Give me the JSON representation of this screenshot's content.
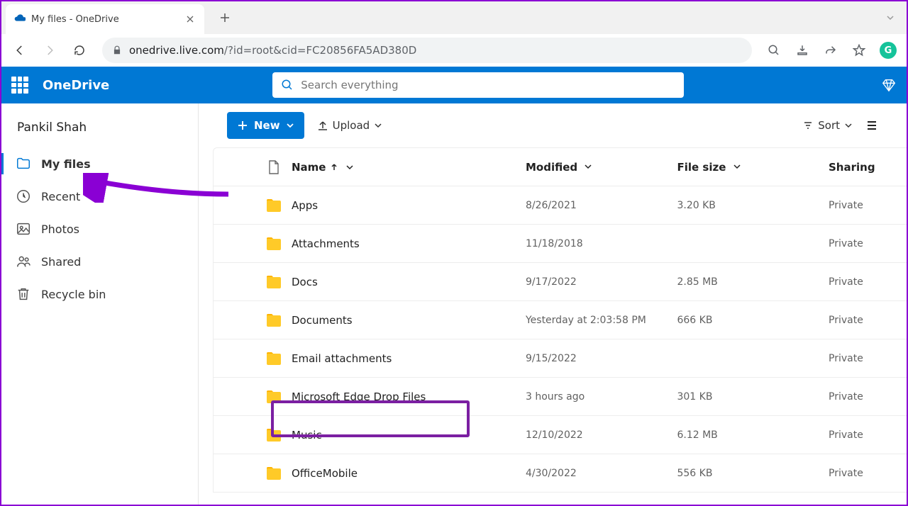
{
  "browser": {
    "tab_title": "My files - OneDrive",
    "url_host": "onedrive.live.com",
    "url_path": "/?id=root&cid=FC20856FA5AD380D"
  },
  "header": {
    "brand": "OneDrive",
    "search_placeholder": "Search everything"
  },
  "user": {
    "name": "Pankil Shah"
  },
  "sidebar": {
    "items": [
      {
        "label": "My files",
        "icon": "folder"
      },
      {
        "label": "Recent",
        "icon": "recent"
      },
      {
        "label": "Photos",
        "icon": "photo"
      },
      {
        "label": "Shared",
        "icon": "people"
      },
      {
        "label": "Recycle bin",
        "icon": "trash"
      }
    ]
  },
  "toolbar": {
    "new_label": "New",
    "upload_label": "Upload",
    "sort_label": "Sort"
  },
  "table": {
    "columns": {
      "name": "Name",
      "modified": "Modified",
      "size": "File size",
      "sharing": "Sharing"
    },
    "rows": [
      {
        "name": "Apps",
        "modified": "8/26/2021",
        "size": "3.20 KB",
        "sharing": "Private"
      },
      {
        "name": "Attachments",
        "modified": "11/18/2018",
        "size": "",
        "sharing": "Private"
      },
      {
        "name": "Docs",
        "modified": "9/17/2022",
        "size": "2.85 MB",
        "sharing": "Private"
      },
      {
        "name": "Documents",
        "modified": "Yesterday at 2:03:58 PM",
        "size": "666 KB",
        "sharing": "Private"
      },
      {
        "name": "Email attachments",
        "modified": "9/15/2022",
        "size": "",
        "sharing": "Private"
      },
      {
        "name": "Microsoft Edge Drop Files",
        "modified": "3 hours ago",
        "size": "301 KB",
        "sharing": "Private"
      },
      {
        "name": "Music",
        "modified": "12/10/2022",
        "size": "6.12 MB",
        "sharing": "Private"
      },
      {
        "name": "OfficeMobile",
        "modified": "4/30/2022",
        "size": "556 KB",
        "sharing": "Private"
      }
    ]
  }
}
